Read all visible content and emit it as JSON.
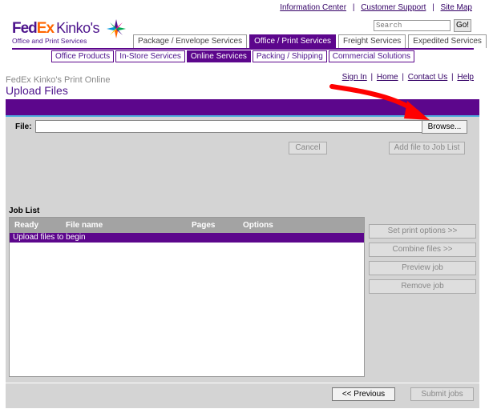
{
  "top_links": {
    "information_center": "Information Center",
    "customer_support": "Customer Support",
    "site_map": "Site Map",
    "separator": "|"
  },
  "logo": {
    "fed": "Fed",
    "ex": "Ex",
    "kinkos": "Kinko's",
    "tagline": "Office and Print Services",
    "colors": {
      "purple": "#4d148c",
      "orange": "#ff6600"
    }
  },
  "search": {
    "placeholder": "Search",
    "go_label": "Go!"
  },
  "main_tabs": [
    {
      "label": "Package / Envelope Services",
      "active": false
    },
    {
      "label": "Office / Print Services",
      "active": true
    },
    {
      "label": "Freight Services",
      "active": false
    },
    {
      "label": "Expedited Services",
      "active": false
    }
  ],
  "sub_tabs": [
    {
      "label": "Office Products",
      "active": false
    },
    {
      "label": "In-Store Services",
      "active": false
    },
    {
      "label": "Online Services",
      "active": true
    },
    {
      "label": "Packing / Shipping",
      "active": false
    },
    {
      "label": "Commercial Solutions",
      "active": false
    }
  ],
  "page": {
    "site_name": "FedEx Kinko's Print Online",
    "title": "Upload Files"
  },
  "page_links": {
    "sign_in": "Sign In",
    "home": "Home",
    "contact_us": "Contact Us",
    "help": "Help",
    "separator": "|"
  },
  "upload": {
    "file_label": "File:",
    "file_value": "",
    "browse_label": "Browse...",
    "cancel_label": "Cancel",
    "add_file_label": "Add file to Job List"
  },
  "job_list": {
    "label": "Job List",
    "columns": [
      "Ready",
      "File name",
      "Pages",
      "Options"
    ],
    "empty_message": "Upload files to begin",
    "actions": {
      "set_print_options": "Set print options >>",
      "combine_files": "Combine files >>",
      "preview_job": "Preview job",
      "remove_job": "Remove job"
    }
  },
  "footer": {
    "previous_label": "<< Previous",
    "submit_label": "Submit jobs"
  },
  "colors": {
    "brand_purple": "#5c068c",
    "accent_blue": "#4faedd",
    "panel_gray": "#d4d4d4",
    "annotation_red": "#ff0000"
  }
}
